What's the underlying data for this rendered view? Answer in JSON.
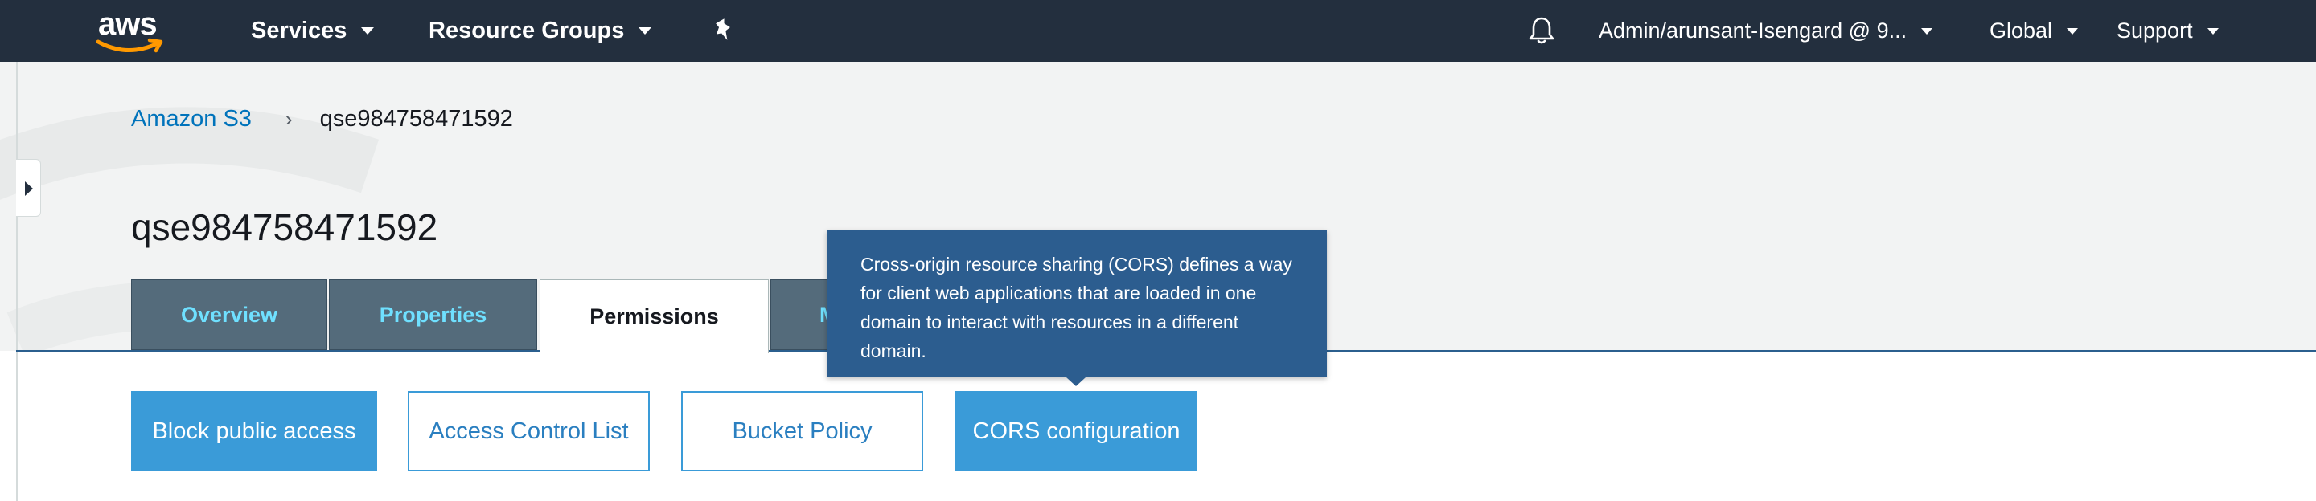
{
  "topnav": {
    "logo_text": "aws",
    "services_label": "Services",
    "resource_groups_label": "Resource Groups",
    "account_label": "Admin/arunsant-Isengard @ 9...",
    "region_label": "Global",
    "support_label": "Support",
    "icons": [
      "aws-logo",
      "pin-icon",
      "bell-icon",
      "chevron-down-icon"
    ]
  },
  "breadcrumb": {
    "root": "Amazon S3",
    "separator": "›",
    "current": "qse984758471592"
  },
  "page_title": "qse984758471592",
  "tabs": [
    {
      "label": "Overview",
      "active": false
    },
    {
      "label": "Properties",
      "active": false
    },
    {
      "label": "Permissions",
      "active": true
    },
    {
      "label": "M",
      "active": false
    }
  ],
  "permission_buttons": [
    {
      "label": "Block public access",
      "style": "filled"
    },
    {
      "label": "Access Control List",
      "style": "outline"
    },
    {
      "label": "Bucket Policy",
      "style": "outline"
    },
    {
      "label": "CORS configuration",
      "style": "filled"
    }
  ],
  "tooltip": {
    "text": "Cross-origin resource sharing (CORS) defines a way for client web applications that are loaded in one domain to interact with resources in a different domain."
  },
  "colors": {
    "nav_bg": "#232f3e",
    "header_bg": "#f2f3f3",
    "link": "#0073bb",
    "tab_inactive_bg": "#546b7b",
    "tab_inactive_text": "#6fe0ff",
    "button_blue": "#3a9bd8",
    "tooltip_bg": "#2c5d8f",
    "aws_orange": "#ff9900"
  }
}
